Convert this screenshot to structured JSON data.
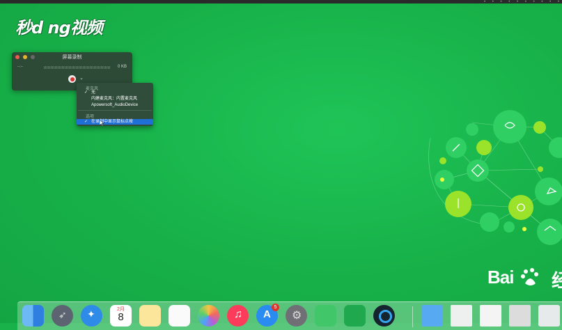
{
  "watermark": "秒d ng视频",
  "recorder": {
    "title": "屏幕录制",
    "time": "--:--",
    "size": "0 KB"
  },
  "menu": {
    "mic_header": "麦克风",
    "items": [
      "无",
      "内建麦克风：内置麦克风",
      "Apowersoft_AudioDevice"
    ],
    "options_header": "选项",
    "option_item": "在录制中显示鼠标点按"
  },
  "brand": {
    "baidu": "Bai  ",
    "suffix": "经"
  },
  "dock": {
    "calendar_month": "2月",
    "calendar_day": "8",
    "appstore_badge": "5"
  },
  "colors": {
    "desktop": "#19b24a",
    "menu_highlight": "#1f6fd6",
    "record": "#d8332e",
    "network_lime": "#9be32a"
  },
  "icons": [
    "finder-icon",
    "launchpad-icon",
    "safari-icon",
    "calendar-icon",
    "notes-icon",
    "reminders-icon",
    "photos-icon",
    "itunes-icon",
    "app-store-icon",
    "system-preferences-icon",
    "facetime-icon",
    "green-app-icon",
    "quicktime-icon",
    "folder-icon",
    "document-icon",
    "document-icon",
    "document-icon",
    "trash-icon"
  ]
}
